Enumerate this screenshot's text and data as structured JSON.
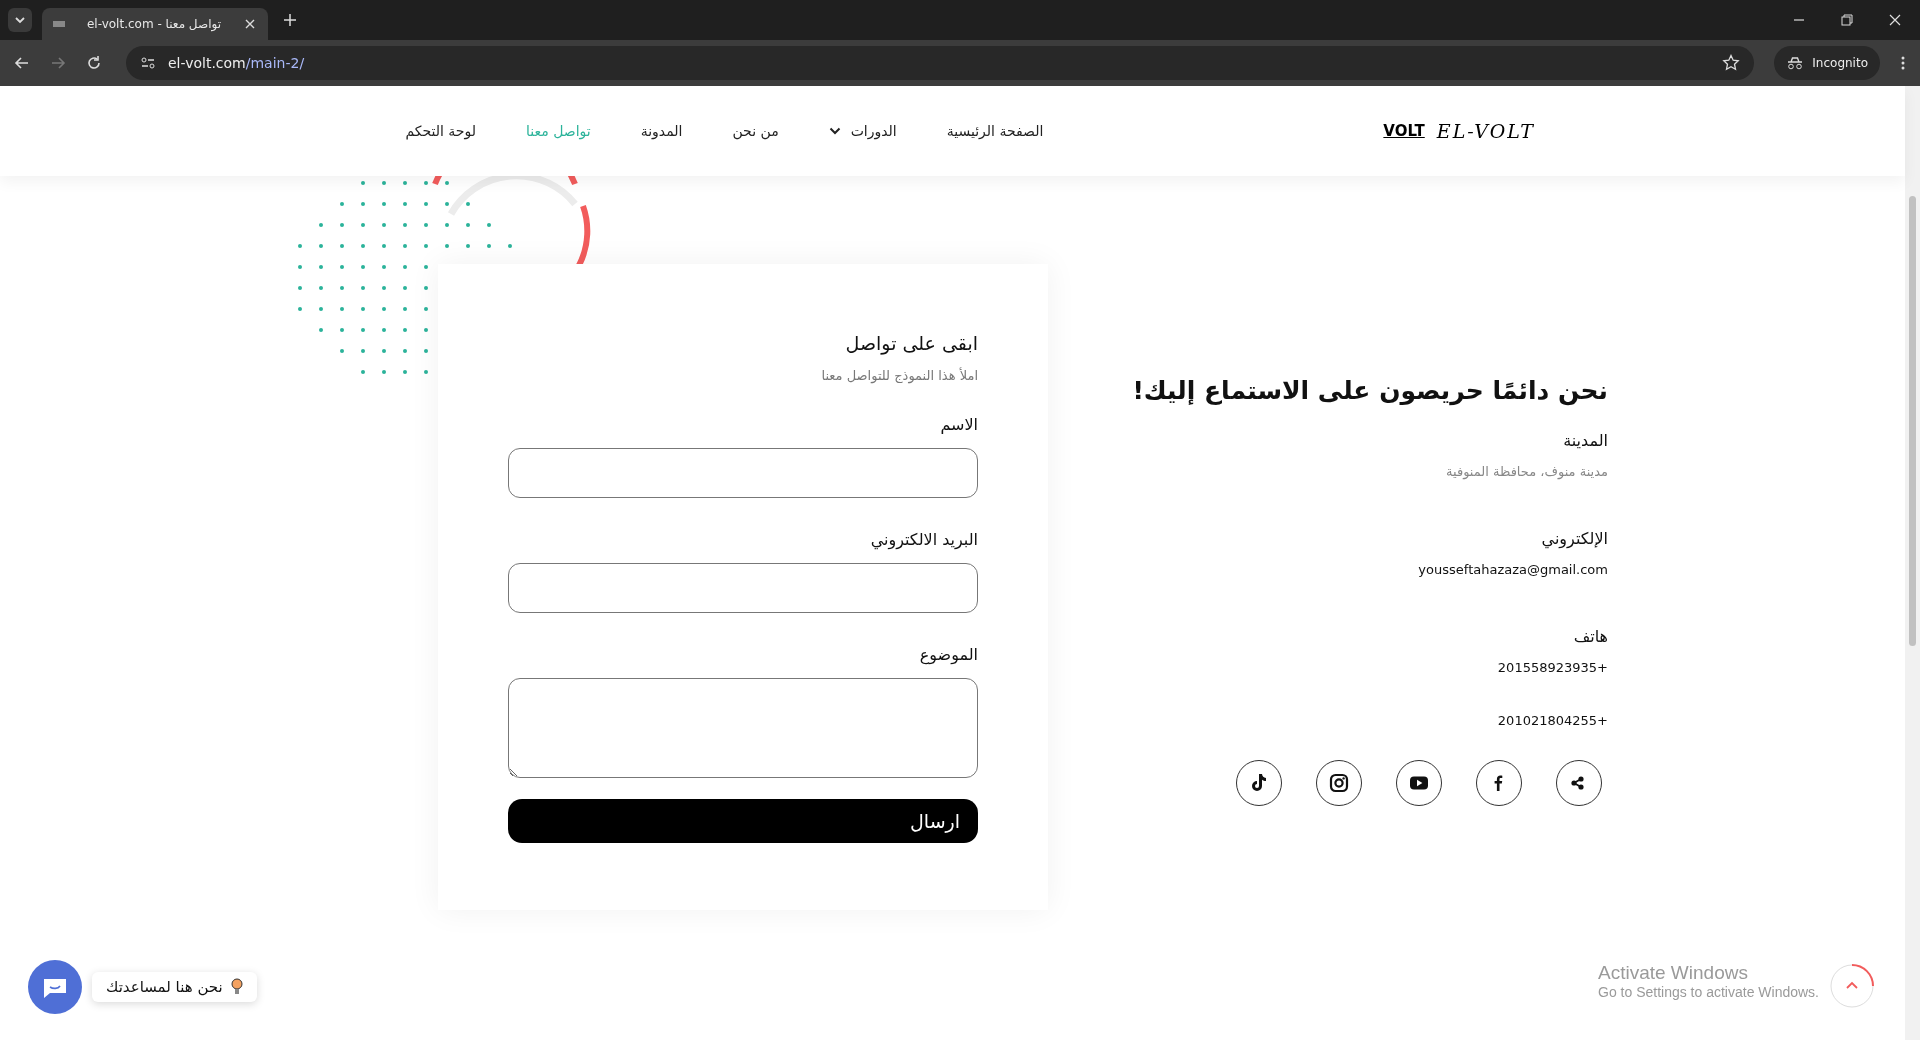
{
  "browser": {
    "tab_title": "el-volt.com - تواصل معنا",
    "url_host": "el-volt.com",
    "url_path": "/main-2/",
    "profile_label": "Incognito"
  },
  "header": {
    "logo_mark": "VOLT",
    "logo_text": "EL-VOLT",
    "nav": [
      {
        "label": "الصفحة الرئيسية",
        "selected": false,
        "dropdown": false
      },
      {
        "label": "الدورات",
        "selected": false,
        "dropdown": true
      },
      {
        "label": "من نحن",
        "selected": false,
        "dropdown": false
      },
      {
        "label": "المدونة",
        "selected": false,
        "dropdown": false
      },
      {
        "label": "تواصل معنا",
        "selected": true,
        "dropdown": false
      },
      {
        "label": "لوحة التحكم",
        "selected": false,
        "dropdown": false
      }
    ]
  },
  "form": {
    "title": "ابقى على تواصل",
    "subtitle": "املأ هذا النموذج للتواصل معنا",
    "fields": [
      {
        "label": "الاسم",
        "kind": "input"
      },
      {
        "label": "البريد الالكتروني",
        "kind": "input"
      },
      {
        "label": "الموضوع",
        "kind": "textarea"
      }
    ],
    "submit": "ارسال"
  },
  "contact": {
    "heading": "نحن دائمًا حريصون على الاستماع إليك!",
    "sections": [
      {
        "title": "المدينة",
        "kind": "muted",
        "values": [
          "مدينة منوف، محافظة المنوفية"
        ]
      },
      {
        "title": "الإلكتروني",
        "kind": "plain",
        "values": [
          "yousseftahazaza@gmail.com"
        ]
      },
      {
        "title": "هاتف",
        "kind": "plain",
        "values": [
          "201558923935+",
          "201021804255+"
        ]
      }
    ],
    "social": [
      {
        "kind": "share"
      },
      {
        "kind": "facebook"
      },
      {
        "kind": "youtube"
      },
      {
        "kind": "instagram"
      },
      {
        "kind": "tiktok"
      }
    ]
  },
  "chat": {
    "label": "نحن هنا لمساعدتك"
  },
  "os_notice": {
    "title": "Activate Windows",
    "subtitle": "Go to Settings to activate Windows."
  }
}
